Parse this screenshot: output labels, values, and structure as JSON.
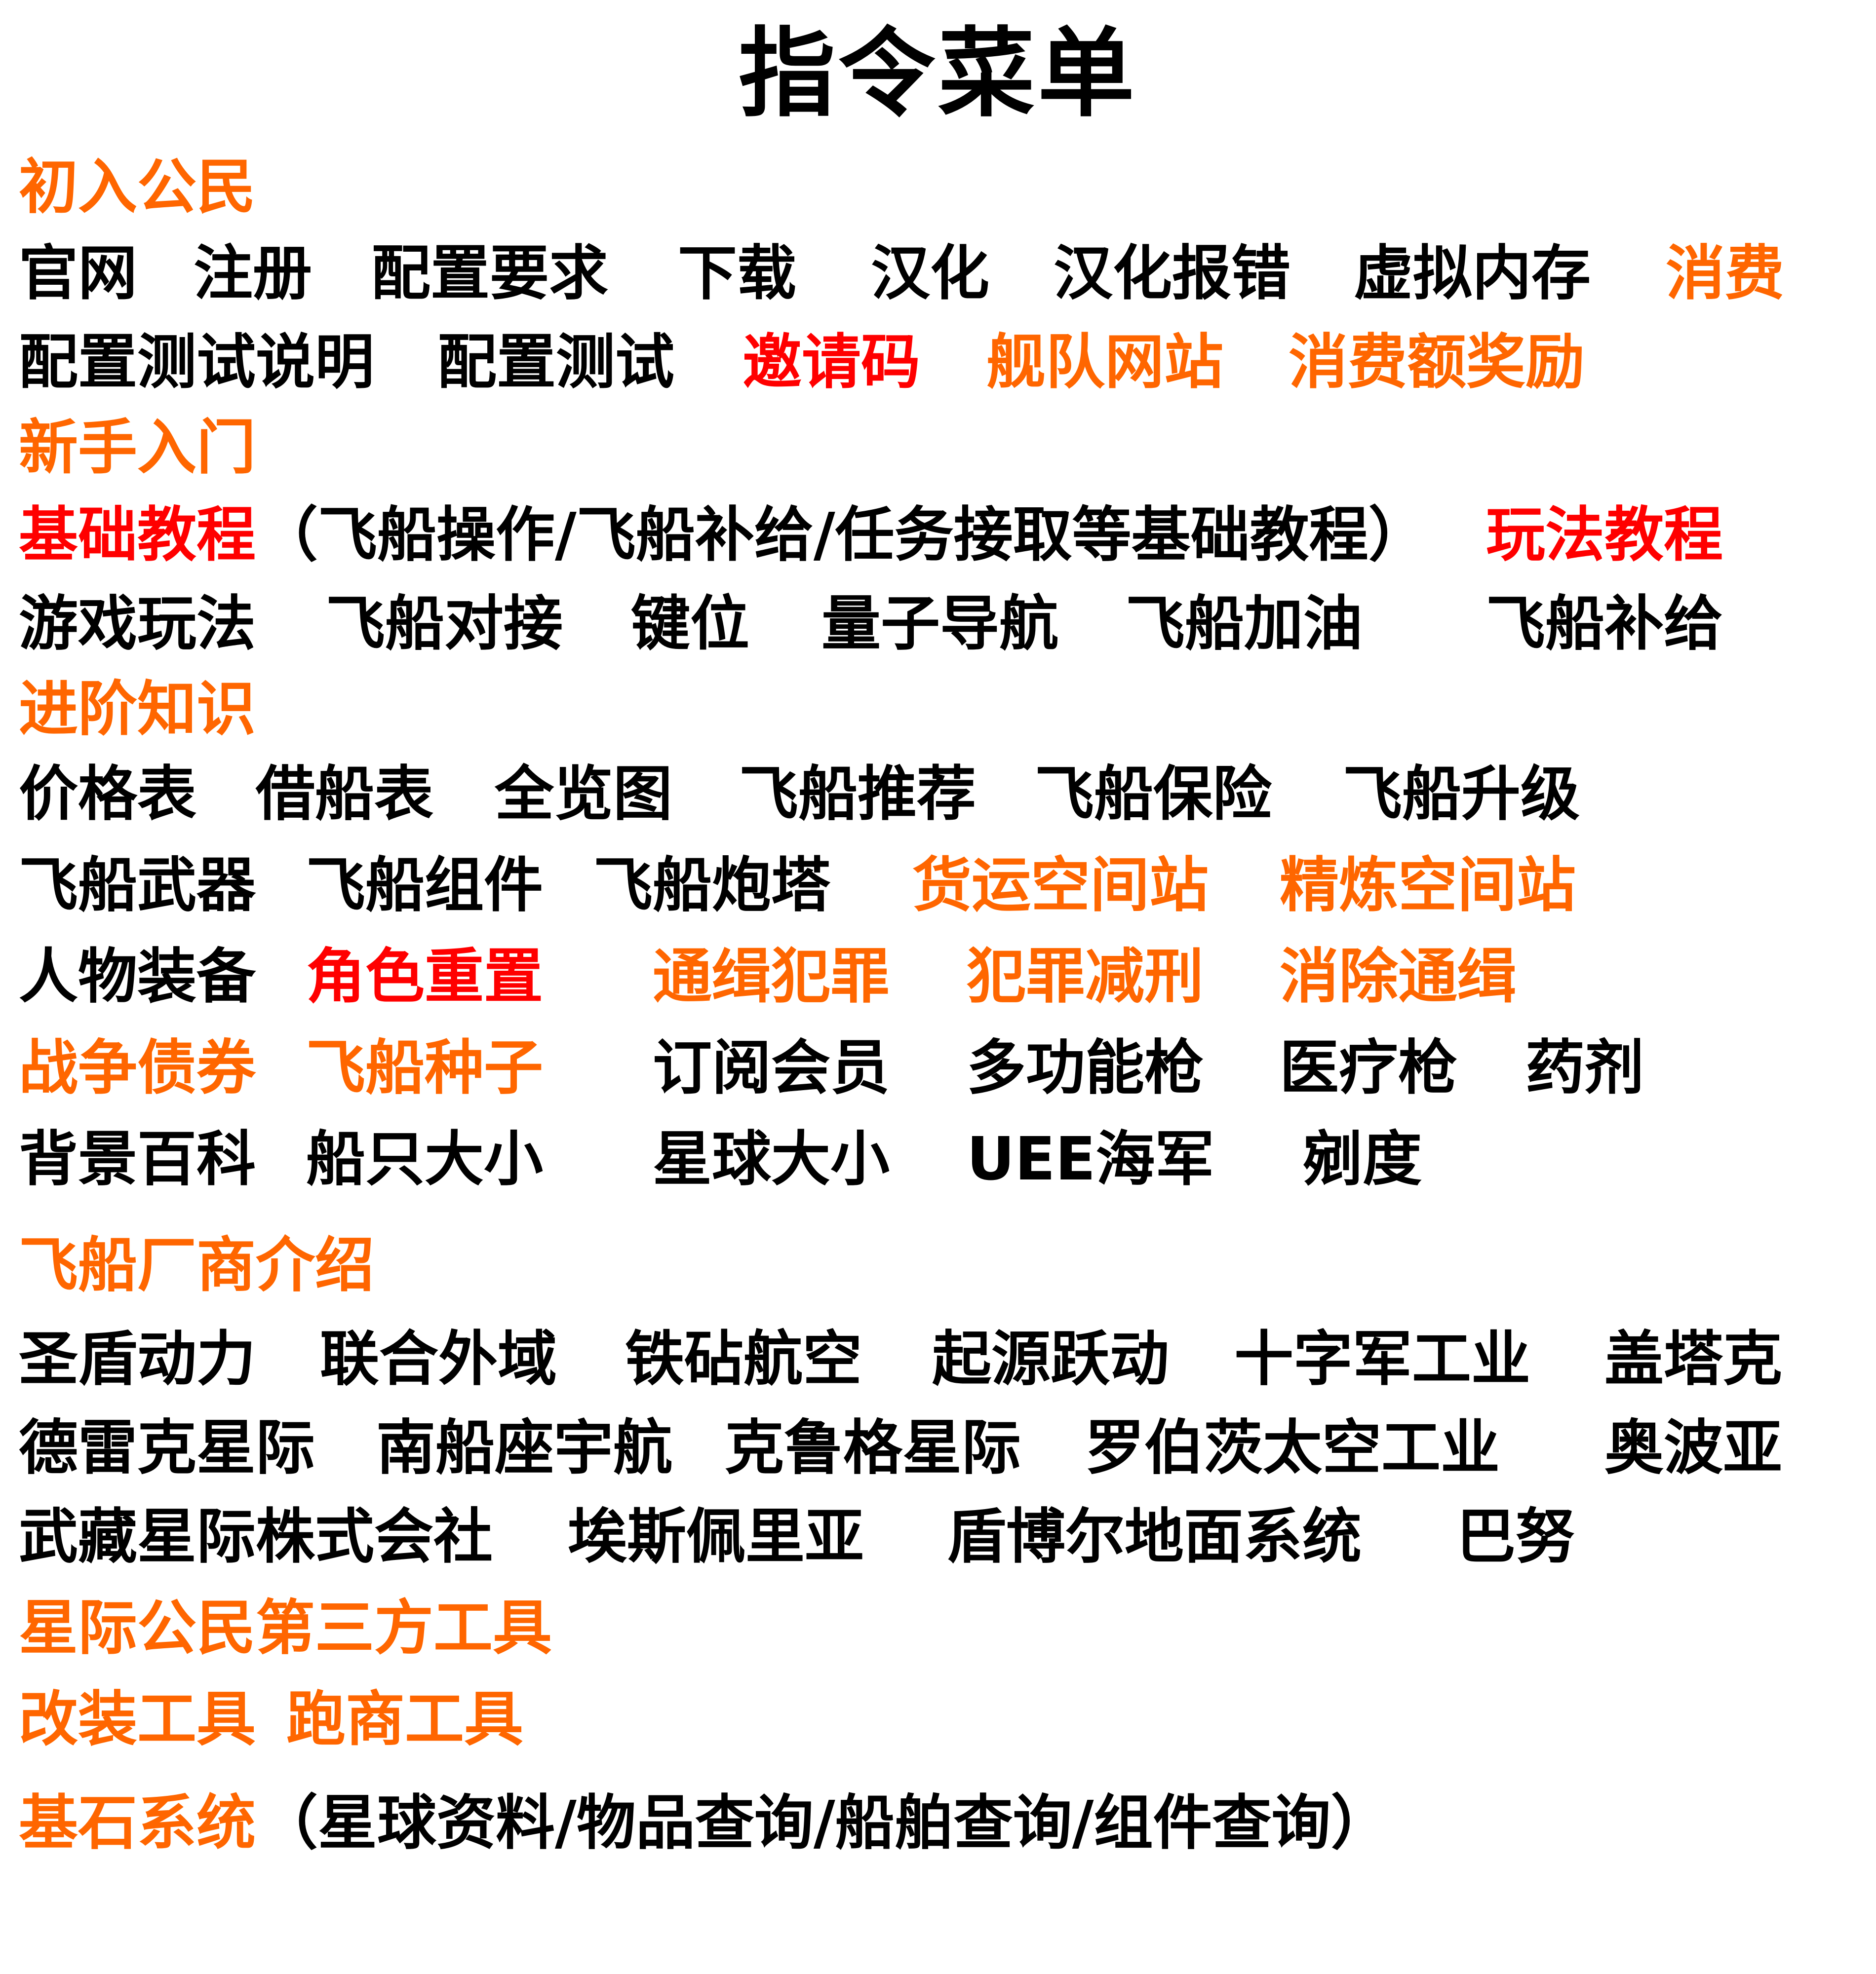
{
  "title": "指令菜单",
  "colors": {
    "text": "#000000",
    "orange": "#FF6600",
    "red": "#FF0000"
  },
  "sections": {
    "s1": "初入公民",
    "s2": "新手入门",
    "s3": "进阶知识",
    "s4": "飞船厂商介绍",
    "s5": "星际公民第三方工具",
    "s6_a": "改装工具",
    "s6_b": "跑商工具"
  },
  "rows": {
    "r1": [
      "官网",
      "注册",
      "配置要求",
      "下载",
      "汉化",
      "汉化报错",
      "虚拟内存",
      "消费"
    ],
    "r2": [
      "配置测试说明",
      "配置测试",
      "邀请码",
      "舰队网站",
      "消费额奖励"
    ],
    "r3": {
      "basic": "基础教程",
      "basic_note": "（飞船操作/飞船补给/任务接取等基础教程）",
      "gameplay": "玩法教程"
    },
    "r4": [
      "游戏玩法",
      "飞船对接",
      "键位",
      "量子导航",
      "飞船加油",
      "飞船补给"
    ],
    "r5": [
      "价格表",
      "借船表",
      "全览图",
      "飞船推荐",
      "飞船保险",
      "飞船升级"
    ],
    "r6": [
      "飞船武器",
      "飞船组件",
      "飞船炮塔",
      "货运空间站",
      "精炼空间站"
    ],
    "r7": [
      "人物装备",
      "角色重置",
      "通缉犯罪",
      "犯罪减刑",
      "消除通缉"
    ],
    "r8": [
      "战争债券",
      "飞船种子",
      "订阅会员",
      "多功能枪",
      "医疗枪",
      "药剂"
    ],
    "r9": [
      "背景百科",
      "船只大小",
      "星球大小",
      "UEE海军",
      "剜度"
    ],
    "r10": [
      "圣盾动力",
      "联合外域",
      "铁砧航空",
      "起源跃动",
      "十字军工业",
      "盖塔克"
    ],
    "r11": [
      "德雷克星际",
      "南船座宇航",
      "克鲁格星际",
      "罗伯茨太空工业",
      "奥波亚"
    ],
    "r12": [
      "武藏星际株式会社",
      "埃斯佩里亚",
      "盾博尔地面系统",
      "巴努"
    ],
    "r13": {
      "keystone": "基石系统",
      "keystone_note": "（星球资料/物品查询/船舶查询/组件查询）"
    }
  }
}
